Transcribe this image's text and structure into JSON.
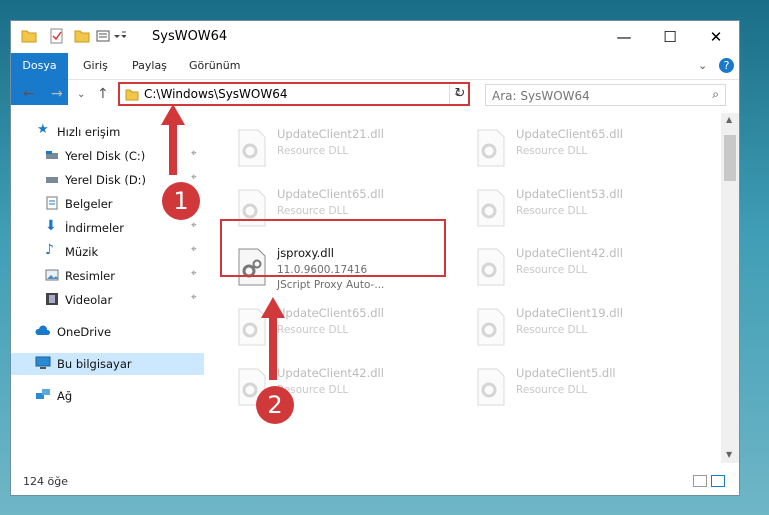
{
  "window": {
    "title": "SysWOW64"
  },
  "ribbon": {
    "tabs": [
      "Dosya",
      "Giriş",
      "Paylaş",
      "Görünüm"
    ]
  },
  "address": {
    "path": "C:\\Windows\\SysWOW64"
  },
  "search": {
    "placeholder": "Ara: SysWOW64"
  },
  "sidebar": {
    "items": [
      {
        "label": "Hızlı erişim",
        "icon": "star-icon"
      },
      {
        "label": "Yerel Disk (C:)",
        "icon": "drive-icon",
        "pinned": true
      },
      {
        "label": "Yerel Disk (D:)",
        "icon": "drive-icon",
        "pinned": true
      },
      {
        "label": "Belgeler",
        "icon": "documents-icon",
        "pinned": true
      },
      {
        "label": "İndirmeler",
        "icon": "download-icon",
        "pinned": true
      },
      {
        "label": "Müzik",
        "icon": "music-icon",
        "pinned": true
      },
      {
        "label": "Resimler",
        "icon": "pictures-icon",
        "pinned": true
      },
      {
        "label": "Videolar",
        "icon": "videos-icon",
        "pinned": true
      },
      {
        "label": "OneDrive",
        "icon": "cloud-icon"
      },
      {
        "label": "Bu bilgisayar",
        "icon": "computer-icon",
        "selected": true
      },
      {
        "label": "Ağ",
        "icon": "network-icon"
      }
    ]
  },
  "files": [
    {
      "name": "UpdateClient21.dll",
      "desc": "Resource DLL"
    },
    {
      "name": "UpdateClient65.dll",
      "desc": "Resource DLL"
    },
    {
      "name": "UpdateClient65.dll",
      "desc": "Resource DLL"
    },
    {
      "name": "UpdateClient53.dll",
      "desc": "Resource DLL"
    },
    {
      "name": "jsproxy.dll",
      "version": "11.0.9600.17416",
      "desc": "JScript Proxy Auto-..."
    },
    {
      "name": "UpdateClient42.dll",
      "desc": "Resource DLL"
    },
    {
      "name": "UpdateClient65.dll",
      "desc": "Resource DLL"
    },
    {
      "name": "UpdateClient19.dll",
      "desc": "Resource DLL"
    },
    {
      "name": "UpdateClient42.dll",
      "desc": "Resource DLL"
    },
    {
      "name": "UpdateClient5.dll",
      "desc": "Resource DLL"
    }
  ],
  "status": {
    "count": "124 öğe"
  },
  "callouts": [
    "1",
    "2"
  ],
  "colors": {
    "accent": "#1979ca",
    "highlight": "#d1383a",
    "selected": "#cce8ff"
  }
}
